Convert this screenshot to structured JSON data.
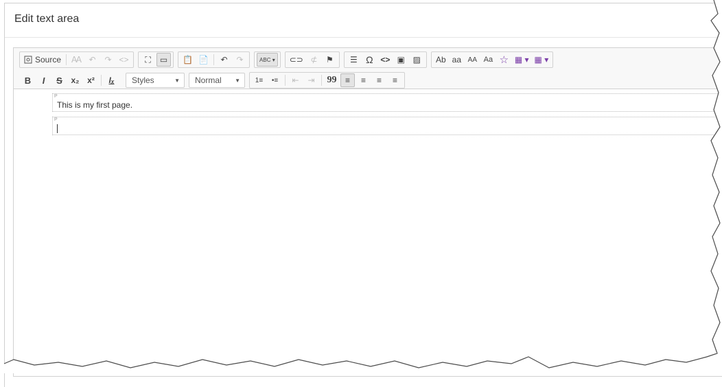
{
  "panel": {
    "title": "Edit text area"
  },
  "toolbar": {
    "source_label": "Source",
    "styles_combo": {
      "value": "Styles"
    },
    "format_combo": {
      "value": "Normal"
    },
    "glyphs": {
      "templates": "⊞",
      "select_all": "Ꜳ",
      "undo_small": "↶",
      "redo_small": "↷",
      "code": "<>",
      "maximize": "⛶",
      "showblocks": "▭",
      "paste": "📋",
      "paste_word": "📄",
      "undo": "↶",
      "redo": "↷",
      "spell": "ABC",
      "link": "⊂⊃",
      "unlink": "⊄",
      "anchor": "⚑",
      "hr": "☰",
      "special_char": "Ω",
      "source_code": "<>",
      "youtube": "▣",
      "image": "▨",
      "transform": "Ab",
      "lower": "aa",
      "upper": "AA",
      "capitalize": "Aa",
      "star": "☆",
      "table": "▦",
      "grid": "▦",
      "bold": "B",
      "italic": "I",
      "strike": "S",
      "subscript": "x₂",
      "superscript": "x²",
      "remove_format": "Iₓ",
      "numbered_list": "1≡",
      "bullet_list": "•≡",
      "outdent": "⇤",
      "indent": "⇥",
      "blockquote": "99",
      "align_left": "≡",
      "align_center": "≡",
      "align_right": "≡",
      "justify": "≡"
    }
  },
  "content": {
    "paragraphs": [
      {
        "tag": "P",
        "text": "This is my first page."
      },
      {
        "tag": "P",
        "text": ""
      }
    ]
  },
  "colors": {
    "accent_purple": "#7b3ea8",
    "toolbar_bg": "#f8f8f8",
    "border": "#d1d1d1"
  }
}
